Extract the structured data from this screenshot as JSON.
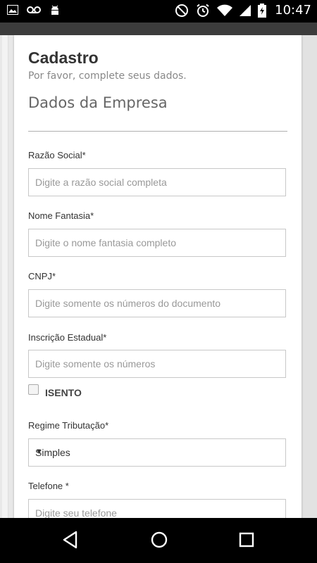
{
  "status_bar": {
    "time": "10:47",
    "icons_left": [
      "image-icon",
      "voicemail-icon",
      "android-icon"
    ],
    "icons_right": [
      "do-not-disturb-icon",
      "alarm-icon",
      "wifi-icon",
      "signal-icon",
      "battery-charging-icon"
    ]
  },
  "form": {
    "title": "Cadastro",
    "subtitle": "Por favor, complete seus dados.",
    "section": "Dados da Empresa",
    "fields": [
      {
        "label": "Razão Social*",
        "placeholder": "Digite a razão social completa"
      },
      {
        "label": "Nome Fantasia*",
        "placeholder": "Digite o nome fantasia completo"
      },
      {
        "label": "CNPJ*",
        "placeholder": "Digite somente os números do documento"
      },
      {
        "label": "Inscrição Estadual*",
        "placeholder": "Digite somente os números"
      },
      {
        "label": "Regime Tributação*",
        "value": "Simples"
      },
      {
        "label": "Telefone *",
        "placeholder": "Digite seu telefone"
      }
    ],
    "checkbox": {
      "label": "ISENTO",
      "checked": false
    }
  },
  "nav": {
    "buttons": [
      "back",
      "home",
      "recents"
    ]
  }
}
